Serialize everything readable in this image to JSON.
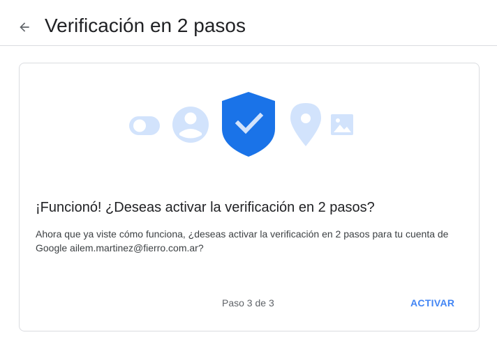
{
  "header": {
    "title": "Verificación en 2 pasos",
    "back_icon": "arrow-back-icon"
  },
  "illustration": {
    "icons": [
      "toggle-icon",
      "account-icon",
      "shield-check-icon",
      "location-pin-icon",
      "image-icon"
    ],
    "colors": {
      "light_blue": "#d2e3fc",
      "shield_blue": "#1a73e8",
      "check_light": "#d2e3fc"
    }
  },
  "card": {
    "title": "¡Funcionó! ¿Deseas activar la verificación en 2 pasos?",
    "body": "Ahora que ya viste cómo funciona, ¿deseas activar la verificación en 2 pasos para tu cuenta de Google ailem.martinez@fierro.com.ar?",
    "step": "Paso 3 de 3",
    "activate_label": "ACTIVAR"
  },
  "colors": {
    "accent": "#4285f4",
    "border": "#dadce0",
    "text_primary": "#202124",
    "text_secondary": "#5f6368"
  }
}
